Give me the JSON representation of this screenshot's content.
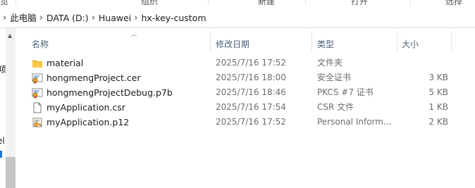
{
  "ribbon": {
    "groups": [
      "览",
      "组织",
      "新建",
      "打开",
      "选择"
    ]
  },
  "address": {
    "crumbs": [
      "此电脑",
      "DATA (D:)",
      "Huawei",
      "hx-key-custom"
    ]
  },
  "nav": {
    "fragments": [
      "项",
      "el"
    ]
  },
  "columns": {
    "name": "名称",
    "date": "修改日期",
    "type": "类型",
    "size": "大小"
  },
  "files": [
    {
      "name": "material",
      "date": "2025/7/16 17:52",
      "type": "文件夹",
      "size": "",
      "icon": "folder-icon"
    },
    {
      "name": "hongmengProject.cer",
      "date": "2025/7/16 18:00",
      "type": "安全证书",
      "size": "3 KB",
      "icon": "certificate-icon"
    },
    {
      "name": "hongmengProjectDebug.p7b",
      "date": "2025/7/16 18:46",
      "type": "PKCS #7 证书",
      "size": "5 KB",
      "icon": "certificate-icon"
    },
    {
      "name": "myApplication.csr",
      "date": "2025/7/16 17:54",
      "type": "CSR 文件",
      "size": "1 KB",
      "icon": "document-icon"
    },
    {
      "name": "myApplication.p12",
      "date": "2025/7/16 17:52",
      "type": "Personal Inform...",
      "size": "2 KB",
      "icon": "personal-certificate-icon"
    }
  ],
  "colors": {
    "header_text": "#4c607a",
    "detail_text": "#6d6d6d",
    "folder": "#f8c94a"
  }
}
